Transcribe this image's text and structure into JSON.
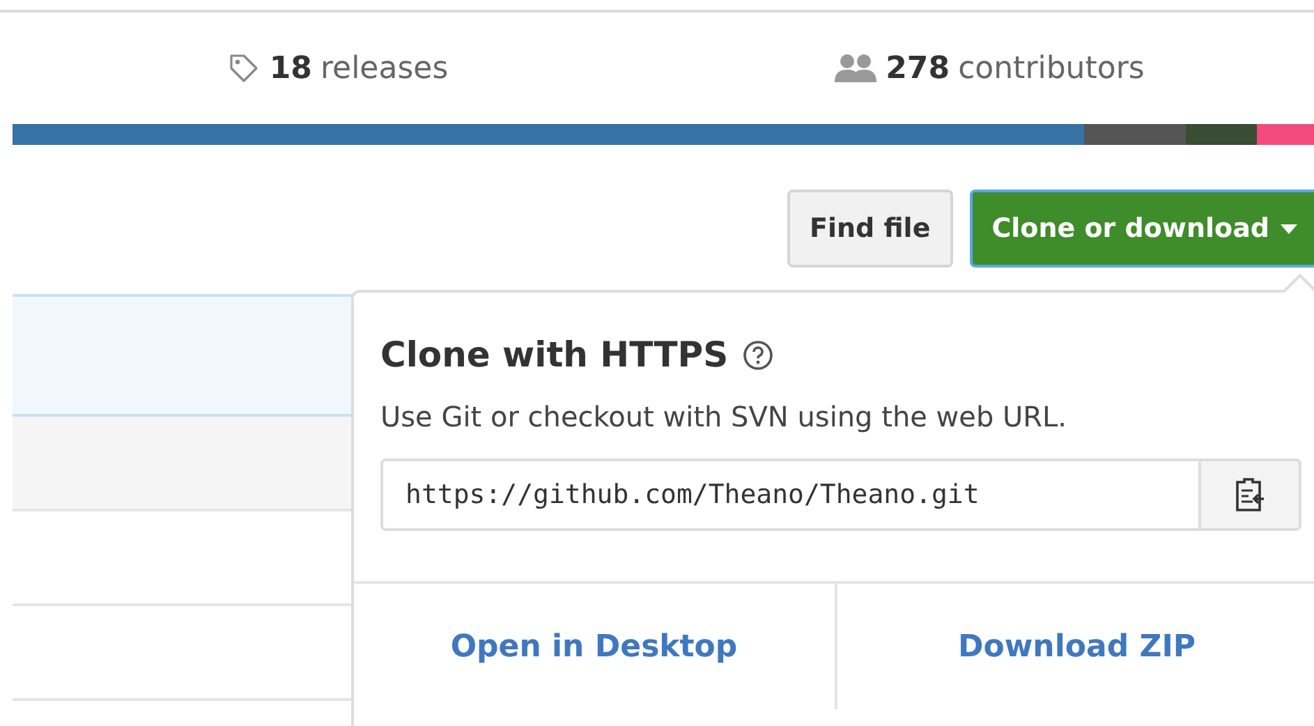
{
  "stats": [
    {
      "kind": "tag",
      "count": "18",
      "label": "releases"
    },
    {
      "kind": "people",
      "count": "278",
      "label": "contributors"
    }
  ],
  "language_bar": [
    {
      "color": "#3572a5"
    },
    {
      "color": "#555555"
    },
    {
      "color": "#384d34"
    },
    {
      "color": "#f34b7d"
    }
  ],
  "buttons": [
    {
      "kind": "plain",
      "label": "Find file"
    },
    {
      "kind": "primary",
      "label": "Clone or download"
    }
  ],
  "file_rows": [
    {
      "kind": "highlight"
    },
    {
      "kind": "shaded"
    },
    {
      "kind": "plain"
    },
    {
      "kind": "plain"
    }
  ],
  "clone_popup": {
    "title": "Clone with HTTPS",
    "description": "Use Git or checkout with SVN using the web URL.",
    "url": "https://github.com/Theano/Theano.git",
    "actions": [
      "Open in Desktop",
      "Download ZIP"
    ]
  }
}
